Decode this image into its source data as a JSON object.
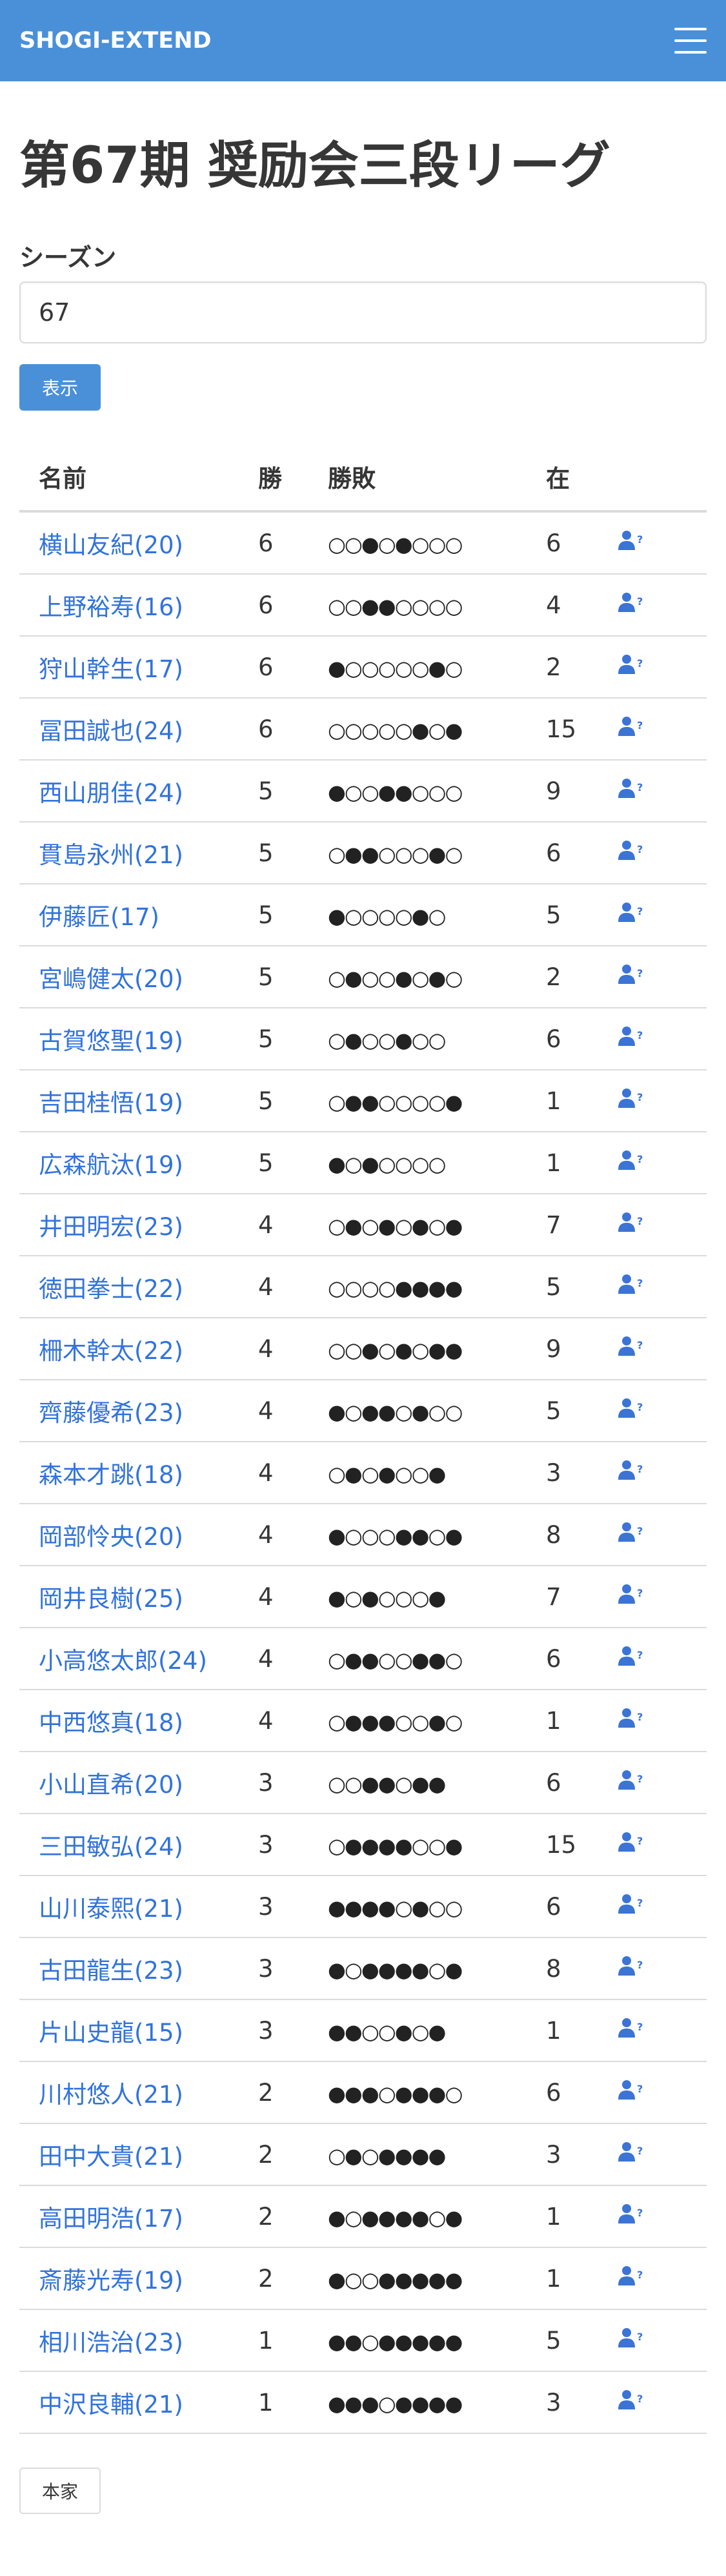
{
  "navbar": {
    "brand": "SHOGI-EXTEND",
    "menu_icon": "hamburger-menu-icon",
    "color": "#4a90d9"
  },
  "page": {
    "title": "第67期 奨励会三段リーグ"
  },
  "season": {
    "label": "シーズン",
    "value": "67"
  },
  "actions": {
    "show_label": "表示",
    "home_label": "本家"
  },
  "table": {
    "headers": {
      "name": "名前",
      "wins": "勝",
      "results": "勝敗",
      "stay": "在"
    },
    "row_icon": "user-question-icon",
    "rows": [
      {
        "name": "横山友紀(20)",
        "wins": "6",
        "results": "○○●○●○○○",
        "stay": "6"
      },
      {
        "name": "上野裕寿(16)",
        "wins": "6",
        "results": "○○●●○○○○",
        "stay": "4"
      },
      {
        "name": "狩山幹生(17)",
        "wins": "6",
        "results": "●○○○○○●○",
        "stay": "2"
      },
      {
        "name": "冨田誠也(24)",
        "wins": "6",
        "results": "○○○○○●○●",
        "stay": "15"
      },
      {
        "name": "西山朋佳(24)",
        "wins": "5",
        "results": "●○○●●○○○",
        "stay": "9"
      },
      {
        "name": "貫島永州(21)",
        "wins": "5",
        "results": "○●●○○○●○",
        "stay": "6"
      },
      {
        "name": "伊藤匠(17)",
        "wins": "5",
        "results": "●○○○○●○",
        "stay": "5"
      },
      {
        "name": "宮嶋健太(20)",
        "wins": "5",
        "results": "○●○○●○●○",
        "stay": "2"
      },
      {
        "name": "古賀悠聖(19)",
        "wins": "5",
        "results": "○●○○●○○",
        "stay": "6"
      },
      {
        "name": "吉田桂悟(19)",
        "wins": "5",
        "results": "○●●○○○○●",
        "stay": "1"
      },
      {
        "name": "広森航汰(19)",
        "wins": "5",
        "results": "●○●○○○○",
        "stay": "1"
      },
      {
        "name": "井田明宏(23)",
        "wins": "4",
        "results": "○●○●○●○●",
        "stay": "7"
      },
      {
        "name": "徳田拳士(22)",
        "wins": "4",
        "results": "○○○○●●●●",
        "stay": "5"
      },
      {
        "name": "柵木幹太(22)",
        "wins": "4",
        "results": "○○●○●○●●",
        "stay": "9"
      },
      {
        "name": "齊藤優希(23)",
        "wins": "4",
        "results": "●○●●○●○○",
        "stay": "5"
      },
      {
        "name": "森本才跳(18)",
        "wins": "4",
        "results": "○●○●○○●",
        "stay": "3"
      },
      {
        "name": "岡部怜央(20)",
        "wins": "4",
        "results": "●○○○●●○●",
        "stay": "8"
      },
      {
        "name": "岡井良樹(25)",
        "wins": "4",
        "results": "●○●○○○●",
        "stay": "7"
      },
      {
        "name": "小高悠太郎(24)",
        "wins": "4",
        "results": "○●●○○●●○",
        "stay": "6"
      },
      {
        "name": "中西悠真(18)",
        "wins": "4",
        "results": "○●●●○○●○",
        "stay": "1"
      },
      {
        "name": "小山直希(20)",
        "wins": "3",
        "results": "○○●●○●●",
        "stay": "6"
      },
      {
        "name": "三田敏弘(24)",
        "wins": "3",
        "results": "○●●●●○○●",
        "stay": "15"
      },
      {
        "name": "山川泰熙(21)",
        "wins": "3",
        "results": "●●●●○●○○",
        "stay": "6"
      },
      {
        "name": "古田龍生(23)",
        "wins": "3",
        "results": "●○●●●●○●",
        "stay": "8"
      },
      {
        "name": "片山史龍(15)",
        "wins": "3",
        "results": "●●○○●○●",
        "stay": "1"
      },
      {
        "name": "川村悠人(21)",
        "wins": "2",
        "results": "●●●○●●●○",
        "stay": "6"
      },
      {
        "name": "田中大貴(21)",
        "wins": "2",
        "results": "○●○●●●●",
        "stay": "3"
      },
      {
        "name": "高田明浩(17)",
        "wins": "2",
        "results": "●○●●●●○●",
        "stay": "1"
      },
      {
        "name": "斎藤光寿(19)",
        "wins": "2",
        "results": "●○○●●●●●",
        "stay": "1"
      },
      {
        "name": "相川浩治(23)",
        "wins": "1",
        "results": "●●○●●●●●",
        "stay": "5"
      },
      {
        "name": "中沢良輔(21)",
        "wins": "1",
        "results": "●●●○●●●●",
        "stay": "3"
      }
    ]
  }
}
